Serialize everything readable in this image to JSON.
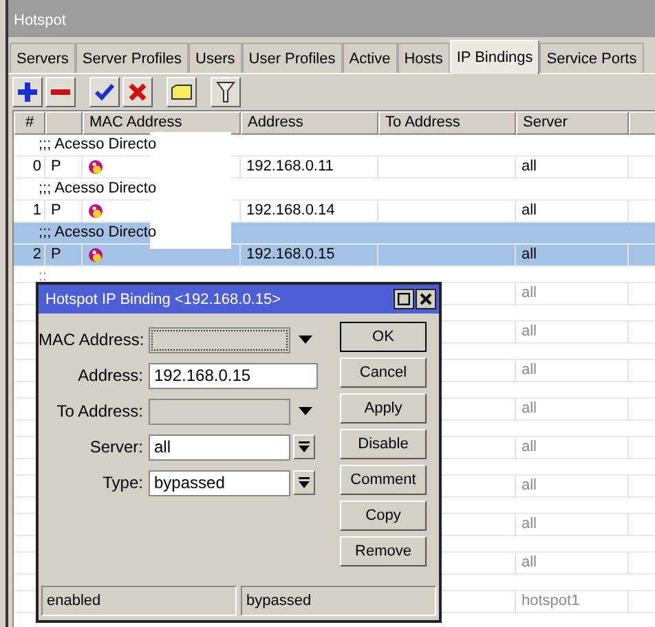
{
  "window": {
    "title": "Hotspot"
  },
  "tabs": [
    {
      "label": "Servers",
      "selected": false
    },
    {
      "label": "Server Profiles",
      "selected": false
    },
    {
      "label": "Users",
      "selected": false
    },
    {
      "label": "User Profiles",
      "selected": false
    },
    {
      "label": "Active",
      "selected": false
    },
    {
      "label": "Hosts",
      "selected": false
    },
    {
      "label": "IP Bindings",
      "selected": true
    },
    {
      "label": "Service Ports",
      "selected": false
    }
  ],
  "table": {
    "columns": [
      "#",
      "",
      "MAC Address",
      "Address",
      "To Address",
      "Server"
    ],
    "rows": [
      {
        "comment": ";;; Acesso Directo",
        "num": "0",
        "flag": "P",
        "address": "192.168.0.11",
        "server": "all",
        "selected": false,
        "disabled": false
      },
      {
        "comment": ";;; Acesso Directo",
        "num": "1",
        "flag": "P",
        "address": "192.168.0.14",
        "server": "all",
        "selected": false,
        "disabled": false
      },
      {
        "comment": ";;; Acesso Directo",
        "num": "2",
        "flag": "P",
        "address": "192.168.0.15",
        "server": "all",
        "selected": true,
        "disabled": false
      },
      {
        "comment": "::",
        "server": "all",
        "selected": false,
        "disabled": true
      },
      {
        "server": "all",
        "selected": false,
        "disabled": true
      },
      {
        "server": "all",
        "selected": false,
        "disabled": true
      },
      {
        "server": "all",
        "selected": false,
        "disabled": true
      },
      {
        "server": "all",
        "selected": false,
        "disabled": true
      },
      {
        "server": "all",
        "selected": false,
        "disabled": true
      },
      {
        "server": "all",
        "selected": false,
        "disabled": true
      },
      {
        "server": "all",
        "selected": false,
        "disabled": true
      },
      {
        "server": "hotspot1",
        "selected": false,
        "disabled": true
      }
    ]
  },
  "dialog": {
    "title": "Hotspot IP Binding <192.168.0.15>",
    "fields": [
      {
        "label": "MAC Address:",
        "kind": "dropdown",
        "focused": true
      },
      {
        "label": "Address:",
        "kind": "text",
        "value": "192.168.0.15",
        "focused": false
      },
      {
        "label": "To Address:",
        "kind": "dropdown",
        "focused": false
      },
      {
        "label": "Server:",
        "kind": "select",
        "value": "all",
        "focused": false
      },
      {
        "label": "Type:",
        "kind": "select",
        "value": "bypassed",
        "focused": false
      }
    ],
    "buttons": [
      {
        "label": "OK",
        "default": true
      },
      {
        "label": "Cancel",
        "default": false
      },
      {
        "label": "Apply",
        "default": false
      },
      {
        "label": "Disable",
        "default": false
      },
      {
        "label": "Comment",
        "default": false
      },
      {
        "label": "Copy",
        "default": false
      },
      {
        "label": "Remove",
        "default": false
      }
    ],
    "status": [
      "enabled",
      "bypassed"
    ]
  }
}
